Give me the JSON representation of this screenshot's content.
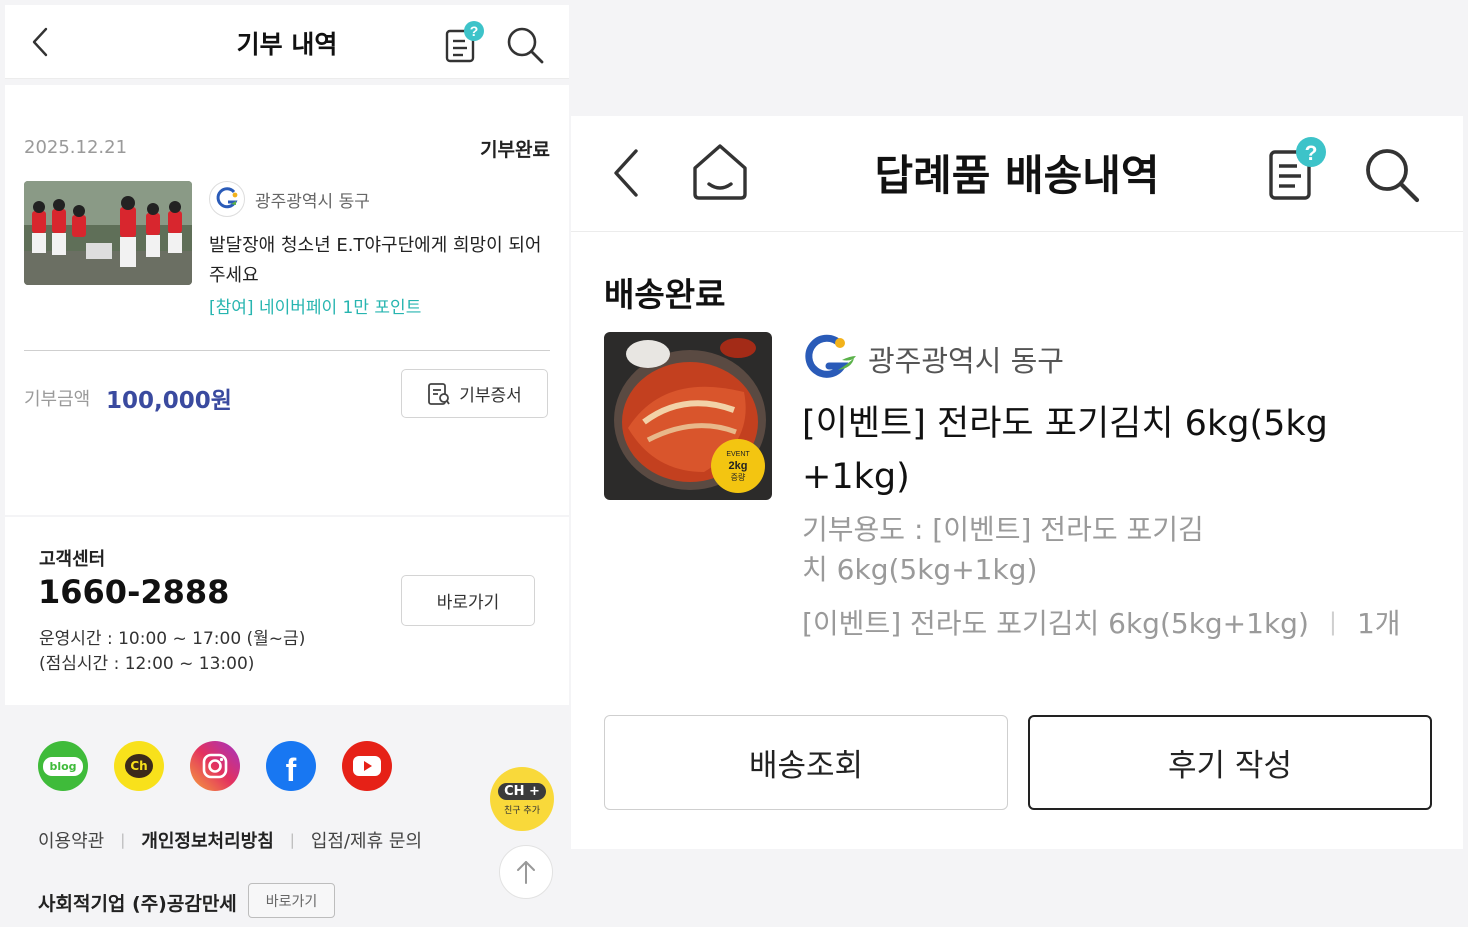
{
  "left": {
    "header": {
      "title": "기부 내역"
    },
    "record": {
      "date": "2025.12.21",
      "status": "기부완료",
      "org_name": "광주광역시 동구",
      "title": "발달장애 청소년 E.T야구단에게 희망이 되어주세요",
      "promo": "[참여] 네이버페이 1만 포인트",
      "amount_label": "기부금액",
      "amount": "100,000원",
      "certificate_label": "기부증서"
    },
    "customer_center": {
      "label": "고객센터",
      "phone": "1660-2888",
      "hours": "운영시간 : 10:00 ~ 17:00 (월~금)",
      "lunch": "(점심시간 : 12:00 ~ 13:00)",
      "go_label": "바로가기"
    },
    "footer": {
      "social": [
        "blog",
        "Ch",
        "instagram",
        "facebook",
        "youtube"
      ],
      "links": [
        "이용약관",
        "개인정보처리방침",
        "입점/제휴 문의"
      ],
      "company": "사회적기업 (주)공감만세",
      "company_go": "바로가기",
      "channel_badge_top": "CH +",
      "channel_badge_bottom": "친구 추가"
    }
  },
  "right": {
    "header": {
      "title": "답례품 배송내역"
    },
    "status": "배송완료",
    "org_name": "광주광역시 동구",
    "product_name": "[이벤트] 전라도 포기김치 6kg(5kg+1kg)",
    "usage": "기부용도 : [이벤트] 전라도 포기김치 6kg(5kg+1kg)",
    "option": "[이벤트] 전라도 포기김치 6kg(5kg+1kg)",
    "quantity": "1개",
    "thumb_badge": [
      "EVENT",
      "2kg",
      "증량"
    ],
    "buttons": {
      "track": "배송조회",
      "review": "후기 작성"
    }
  },
  "colors": {
    "accent": "#3a4a9f",
    "promo": "#27b5b0",
    "badge": "#3dc3c9"
  }
}
